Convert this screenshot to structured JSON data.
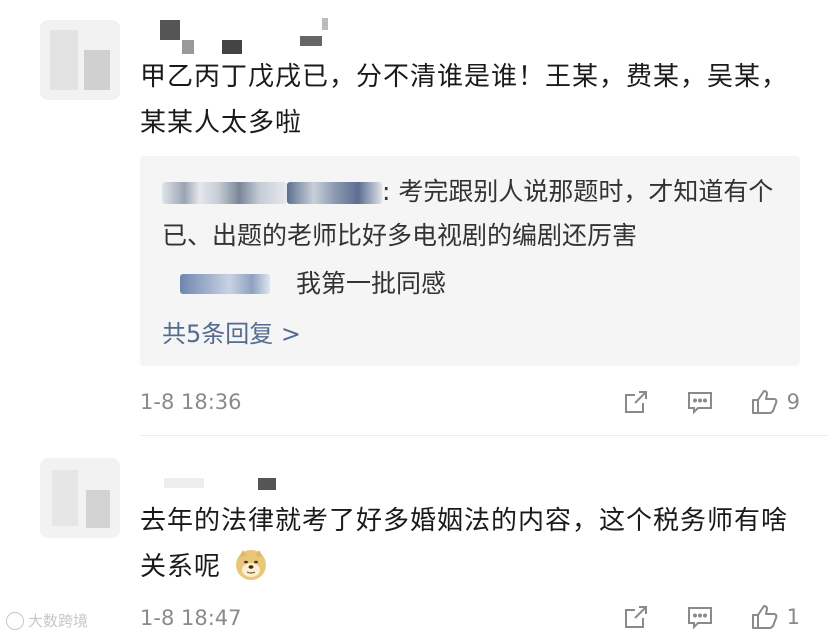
{
  "comments": [
    {
      "text": "甲乙丙丁戊戌已，分不清谁是谁！王某，费某，吴某，某某人太多啦",
      "replies": {
        "first_text": ": 考完跟别人说那题时，才知道有个已、出题的老师比好多电视剧的编剧还厉害",
        "second_text": "我第一批同感",
        "count_label": "共5条回复 >"
      },
      "time": "1-8 18:36",
      "actions": {
        "share_icon": "share-icon",
        "comment_icon": "comment-icon",
        "like_icon": "thumbs-up-icon",
        "like_count": "9"
      }
    },
    {
      "text": "去年的法律就考了好多婚姻法的内容，这个税务师有啥关系呢",
      "emoji": "doge-emoji",
      "time": "1-8 18:47",
      "actions": {
        "share_icon": "share-icon",
        "comment_icon": "comment-icon",
        "like_icon": "thumbs-up-icon",
        "like_count": "1"
      }
    }
  ],
  "watermark": {
    "text": "大数跨境"
  },
  "colors": {
    "link": "#516b91",
    "meta": "#8a8a8a",
    "reply_bg": "#f5f5f5"
  }
}
